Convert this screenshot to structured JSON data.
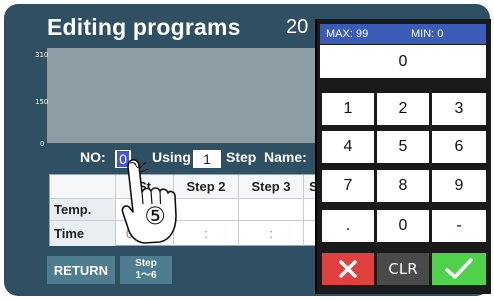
{
  "header": {
    "title": "Editing programs",
    "date_partial": "20"
  },
  "graph": {
    "y_ticks": [
      "310",
      "150",
      "0"
    ]
  },
  "program": {
    "no_label": "NO:",
    "no_value": "0",
    "using_label": "Using",
    "using_value": "1",
    "step_label": "Step",
    "name_label": "Name:"
  },
  "table": {
    "headers": [
      "",
      "St",
      "Step 2",
      "Step 3",
      "S"
    ],
    "rows": [
      {
        "label": "Temp.",
        "cells": [
          "",
          "",
          "",
          ""
        ]
      },
      {
        "label": "Time",
        "cells": [
          "0",
          ":",
          ":",
          ""
        ]
      }
    ]
  },
  "footer": {
    "return_label": "RETURN",
    "step_line1": "Step",
    "step_line2": "1～6"
  },
  "keypad": {
    "max_label": "MAX: 99",
    "min_label": "MIN: 0",
    "display": "0",
    "keys": [
      "1",
      "2",
      "3",
      "4",
      "5",
      "6",
      "7",
      "8",
      "9",
      ".",
      "0",
      "-"
    ],
    "clear_label": "CLR",
    "cancel_icon": "x-icon",
    "confirm_icon": "check-icon",
    "colors": {
      "cancel": "#e0413f",
      "confirm": "#4fd14c",
      "range_bar": "#3b5bb8"
    }
  },
  "annotation": {
    "step_marker": "⑤"
  }
}
